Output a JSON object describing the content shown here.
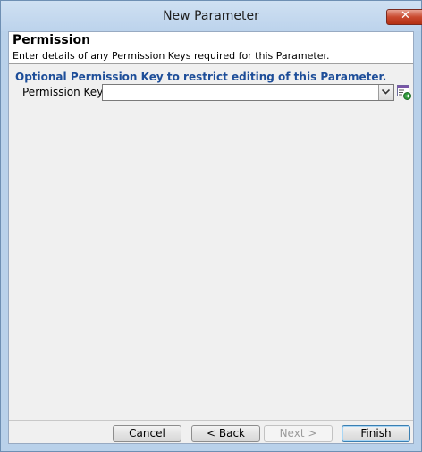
{
  "window": {
    "title": "New Parameter"
  },
  "header": {
    "title": "Permission",
    "description": "Enter details of any Permission Keys required for this Parameter."
  },
  "section": {
    "label": "Optional Permission Key to restrict editing of this Parameter."
  },
  "permission_key": {
    "label": "Permission Key:",
    "value": ""
  },
  "buttons": {
    "cancel": "Cancel",
    "back": "< Back",
    "next": "Next >",
    "finish": "Finish"
  },
  "icons": {
    "close": "close-icon",
    "dropdown": "chevron-down-icon",
    "lookup": "lookup-icon"
  }
}
